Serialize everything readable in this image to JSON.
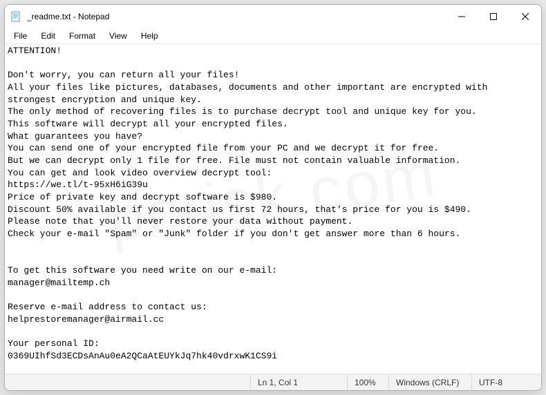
{
  "window": {
    "title": "_readme.txt - Notepad"
  },
  "menu": {
    "file": "File",
    "edit": "Edit",
    "format": "Format",
    "view": "View",
    "help": "Help"
  },
  "document": {
    "text": "ATTENTION!\n\nDon't worry, you can return all your files!\nAll your files like pictures, databases, documents and other important are encrypted with strongest encryption and unique key.\nThe only method of recovering files is to purchase decrypt tool and unique key for you.\nThis software will decrypt all your encrypted files.\nWhat guarantees you have?\nYou can send one of your encrypted file from your PC and we decrypt it for free.\nBut we can decrypt only 1 file for free. File must not contain valuable information.\nYou can get and look video overview decrypt tool:\nhttps://we.tl/t-95xH6iG39u\nPrice of private key and decrypt software is $980.\nDiscount 50% available if you contact us first 72 hours, that's price for you is $490.\nPlease note that you'll never restore your data without payment.\nCheck your e-mail \"Spam\" or \"Junk\" folder if you don't get answer more than 6 hours.\n\n\nTo get this software you need write on our e-mail:\nmanager@mailtemp.ch\n\nReserve e-mail address to contact us:\nhelprestoremanager@airmail.cc\n\nYour personal ID:\n0369UIhfSd3ECDsAnAu0eA2QCaAtEUYkJq7hk40vdrxwK1CS9i"
  },
  "statusbar": {
    "position": "Ln 1, Col 1",
    "zoom": "100%",
    "eol": "Windows (CRLF)",
    "encoding": "UTF-8"
  },
  "watermark": "pcrisk.com"
}
